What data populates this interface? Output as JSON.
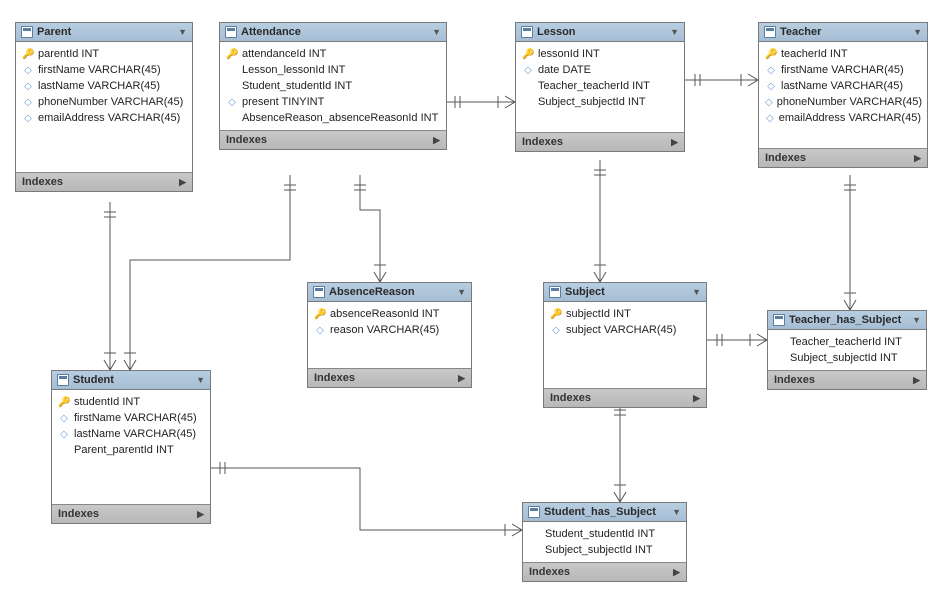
{
  "tables": {
    "parent": {
      "title": "Parent",
      "columns": [
        {
          "icon": "key",
          "text": "parentId INT"
        },
        {
          "icon": "dia",
          "text": "firstName VARCHAR(45)"
        },
        {
          "icon": "dia",
          "text": "lastName VARCHAR(45)"
        },
        {
          "icon": "dia",
          "text": "phoneNumber VARCHAR(45)"
        },
        {
          "icon": "dia",
          "text": "emailAddress VARCHAR(45)"
        }
      ],
      "footer": "Indexes"
    },
    "attendance": {
      "title": "Attendance",
      "columns": [
        {
          "icon": "key",
          "text": "attendanceId INT"
        },
        {
          "icon": "blank",
          "text": "Lesson_lessonId INT"
        },
        {
          "icon": "blank",
          "text": "Student_studentId INT"
        },
        {
          "icon": "dia",
          "text": "present TINYINT"
        },
        {
          "icon": "blank",
          "text": "AbsenceReason_absenceReasonId INT"
        }
      ],
      "footer": "Indexes"
    },
    "lesson": {
      "title": "Lesson",
      "columns": [
        {
          "icon": "key",
          "text": "lessonId INT"
        },
        {
          "icon": "dia",
          "text": "date DATE"
        },
        {
          "icon": "blank",
          "text": "Teacher_teacherId INT"
        },
        {
          "icon": "blank",
          "text": "Subject_subjectId INT"
        }
      ],
      "footer": "Indexes"
    },
    "teacher": {
      "title": "Teacher",
      "columns": [
        {
          "icon": "key",
          "text": "teacherId INT"
        },
        {
          "icon": "dia",
          "text": "firstName VARCHAR(45)"
        },
        {
          "icon": "dia",
          "text": "lastName VARCHAR(45)"
        },
        {
          "icon": "dia",
          "text": "phoneNumber VARCHAR(45)"
        },
        {
          "icon": "dia",
          "text": "emailAddress VARCHAR(45)"
        }
      ],
      "footer": "Indexes"
    },
    "absenceReason": {
      "title": "AbsenceReason",
      "columns": [
        {
          "icon": "key",
          "text": "absenceReasonId INT"
        },
        {
          "icon": "dia",
          "text": "reason VARCHAR(45)"
        }
      ],
      "footer": "Indexes"
    },
    "subject": {
      "title": "Subject",
      "columns": [
        {
          "icon": "key",
          "text": "subjectId INT"
        },
        {
          "icon": "dia",
          "text": "subject VARCHAR(45)"
        }
      ],
      "footer": "Indexes"
    },
    "teacherHasSubject": {
      "title": "Teacher_has_Subject",
      "columns": [
        {
          "icon": "blank",
          "text": "Teacher_teacherId INT"
        },
        {
          "icon": "blank",
          "text": "Subject_subjectId INT"
        }
      ],
      "footer": "Indexes"
    },
    "student": {
      "title": "Student",
      "columns": [
        {
          "icon": "key",
          "text": "studentId INT"
        },
        {
          "icon": "dia",
          "text": "firstName VARCHAR(45)"
        },
        {
          "icon": "dia",
          "text": "lastName VARCHAR(45)"
        },
        {
          "icon": "blank",
          "text": "Parent_parentId INT"
        }
      ],
      "footer": "Indexes"
    },
    "studentHasSubject": {
      "title": "Student_has_Subject",
      "columns": [
        {
          "icon": "blank",
          "text": "Student_studentId INT"
        },
        {
          "icon": "blank",
          "text": "Subject_subjectId INT"
        }
      ],
      "footer": "Indexes"
    }
  }
}
